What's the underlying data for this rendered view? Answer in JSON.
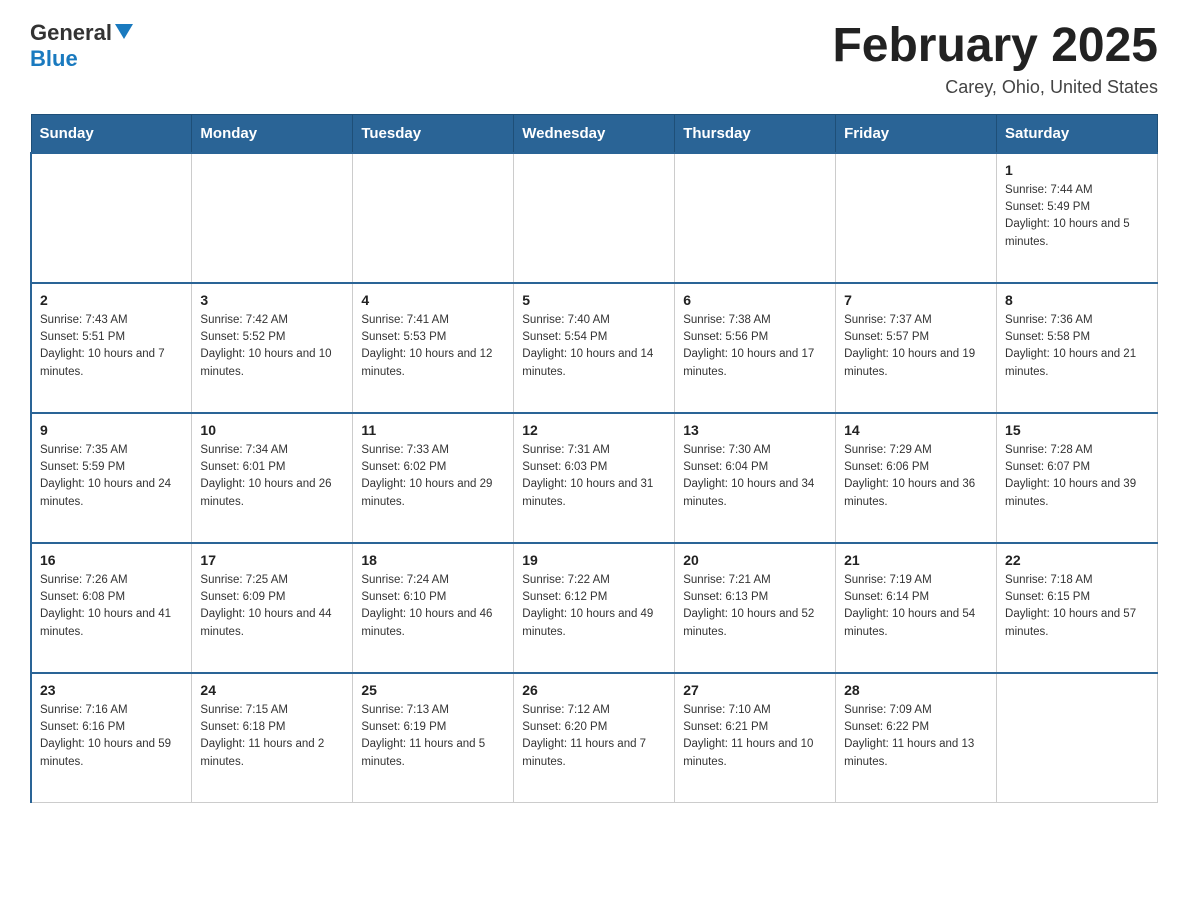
{
  "header": {
    "logo_general": "General",
    "logo_blue": "Blue",
    "month_title": "February 2025",
    "location": "Carey, Ohio, United States"
  },
  "days_of_week": [
    "Sunday",
    "Monday",
    "Tuesday",
    "Wednesday",
    "Thursday",
    "Friday",
    "Saturday"
  ],
  "weeks": [
    [
      {
        "day": "",
        "info": ""
      },
      {
        "day": "",
        "info": ""
      },
      {
        "day": "",
        "info": ""
      },
      {
        "day": "",
        "info": ""
      },
      {
        "day": "",
        "info": ""
      },
      {
        "day": "",
        "info": ""
      },
      {
        "day": "1",
        "info": "Sunrise: 7:44 AM\nSunset: 5:49 PM\nDaylight: 10 hours and 5 minutes."
      }
    ],
    [
      {
        "day": "2",
        "info": "Sunrise: 7:43 AM\nSunset: 5:51 PM\nDaylight: 10 hours and 7 minutes."
      },
      {
        "day": "3",
        "info": "Sunrise: 7:42 AM\nSunset: 5:52 PM\nDaylight: 10 hours and 10 minutes."
      },
      {
        "day": "4",
        "info": "Sunrise: 7:41 AM\nSunset: 5:53 PM\nDaylight: 10 hours and 12 minutes."
      },
      {
        "day": "5",
        "info": "Sunrise: 7:40 AM\nSunset: 5:54 PM\nDaylight: 10 hours and 14 minutes."
      },
      {
        "day": "6",
        "info": "Sunrise: 7:38 AM\nSunset: 5:56 PM\nDaylight: 10 hours and 17 minutes."
      },
      {
        "day": "7",
        "info": "Sunrise: 7:37 AM\nSunset: 5:57 PM\nDaylight: 10 hours and 19 minutes."
      },
      {
        "day": "8",
        "info": "Sunrise: 7:36 AM\nSunset: 5:58 PM\nDaylight: 10 hours and 21 minutes."
      }
    ],
    [
      {
        "day": "9",
        "info": "Sunrise: 7:35 AM\nSunset: 5:59 PM\nDaylight: 10 hours and 24 minutes."
      },
      {
        "day": "10",
        "info": "Sunrise: 7:34 AM\nSunset: 6:01 PM\nDaylight: 10 hours and 26 minutes."
      },
      {
        "day": "11",
        "info": "Sunrise: 7:33 AM\nSunset: 6:02 PM\nDaylight: 10 hours and 29 minutes."
      },
      {
        "day": "12",
        "info": "Sunrise: 7:31 AM\nSunset: 6:03 PM\nDaylight: 10 hours and 31 minutes."
      },
      {
        "day": "13",
        "info": "Sunrise: 7:30 AM\nSunset: 6:04 PM\nDaylight: 10 hours and 34 minutes."
      },
      {
        "day": "14",
        "info": "Sunrise: 7:29 AM\nSunset: 6:06 PM\nDaylight: 10 hours and 36 minutes."
      },
      {
        "day": "15",
        "info": "Sunrise: 7:28 AM\nSunset: 6:07 PM\nDaylight: 10 hours and 39 minutes."
      }
    ],
    [
      {
        "day": "16",
        "info": "Sunrise: 7:26 AM\nSunset: 6:08 PM\nDaylight: 10 hours and 41 minutes."
      },
      {
        "day": "17",
        "info": "Sunrise: 7:25 AM\nSunset: 6:09 PM\nDaylight: 10 hours and 44 minutes."
      },
      {
        "day": "18",
        "info": "Sunrise: 7:24 AM\nSunset: 6:10 PM\nDaylight: 10 hours and 46 minutes."
      },
      {
        "day": "19",
        "info": "Sunrise: 7:22 AM\nSunset: 6:12 PM\nDaylight: 10 hours and 49 minutes."
      },
      {
        "day": "20",
        "info": "Sunrise: 7:21 AM\nSunset: 6:13 PM\nDaylight: 10 hours and 52 minutes."
      },
      {
        "day": "21",
        "info": "Sunrise: 7:19 AM\nSunset: 6:14 PM\nDaylight: 10 hours and 54 minutes."
      },
      {
        "day": "22",
        "info": "Sunrise: 7:18 AM\nSunset: 6:15 PM\nDaylight: 10 hours and 57 minutes."
      }
    ],
    [
      {
        "day": "23",
        "info": "Sunrise: 7:16 AM\nSunset: 6:16 PM\nDaylight: 10 hours and 59 minutes."
      },
      {
        "day": "24",
        "info": "Sunrise: 7:15 AM\nSunset: 6:18 PM\nDaylight: 11 hours and 2 minutes."
      },
      {
        "day": "25",
        "info": "Sunrise: 7:13 AM\nSunset: 6:19 PM\nDaylight: 11 hours and 5 minutes."
      },
      {
        "day": "26",
        "info": "Sunrise: 7:12 AM\nSunset: 6:20 PM\nDaylight: 11 hours and 7 minutes."
      },
      {
        "day": "27",
        "info": "Sunrise: 7:10 AM\nSunset: 6:21 PM\nDaylight: 11 hours and 10 minutes."
      },
      {
        "day": "28",
        "info": "Sunrise: 7:09 AM\nSunset: 6:22 PM\nDaylight: 11 hours and 13 minutes."
      },
      {
        "day": "",
        "info": ""
      }
    ]
  ]
}
